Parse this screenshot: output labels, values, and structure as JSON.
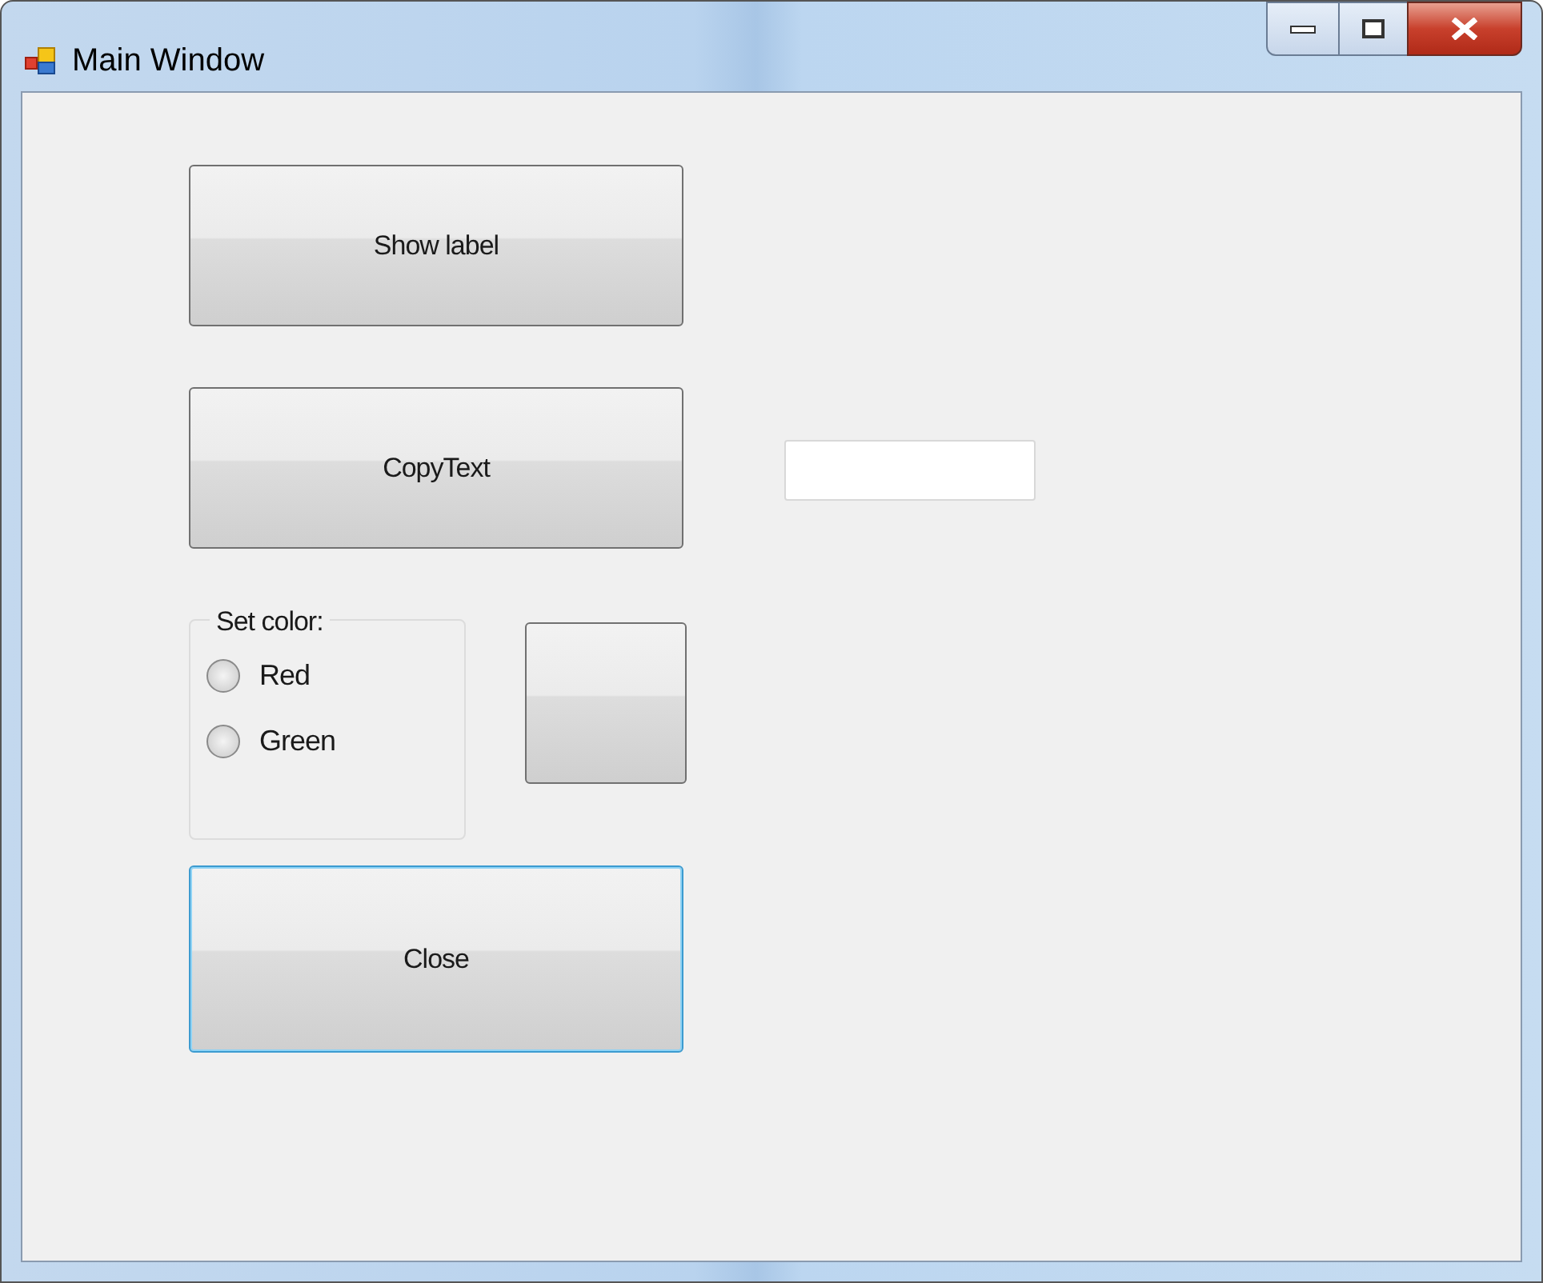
{
  "window": {
    "title": "Main Window"
  },
  "buttons": [
    {
      "label": "Show label",
      "focused": false
    },
    {
      "label": "CopyText",
      "focused": false
    }
  ],
  "group": {
    "title": "Set color:",
    "options": [
      {
        "label": "Red",
        "selected": false
      },
      {
        "label": "Green",
        "selected": false
      }
    ]
  },
  "color_button": {
    "focused": false
  },
  "close_button": {
    "label": "Close",
    "focused": true
  }
}
